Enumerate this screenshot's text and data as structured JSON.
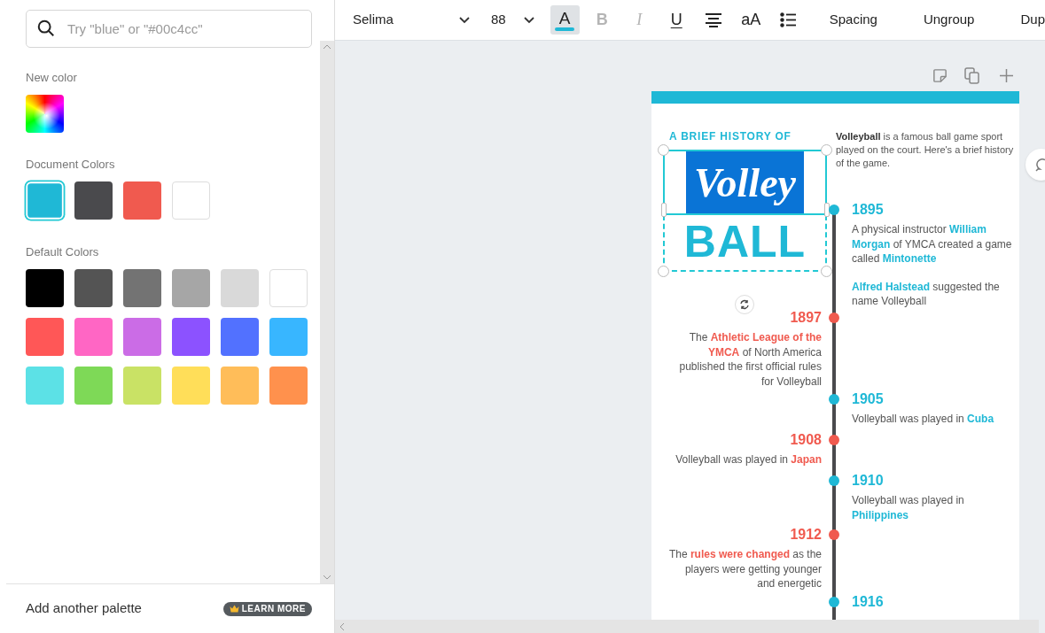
{
  "color_panel": {
    "search": {
      "placeholder": "Try \"blue\" or \"#00c4cc\""
    },
    "new_color": {
      "label": "New color"
    },
    "document_colors": {
      "label": "Document Colors",
      "swatches": [
        {
          "color": "#1fb8d6",
          "selected": true
        },
        {
          "color": "#4a4a4d",
          "selected": false
        },
        {
          "color": "#f05a4f",
          "selected": false
        },
        {
          "color": "#ffffff",
          "selected": false
        }
      ]
    },
    "default_colors": {
      "label": "Default Colors",
      "swatches": [
        {
          "color": "#000000",
          "selected": false
        },
        {
          "color": "#545454",
          "selected": false
        },
        {
          "color": "#737373",
          "selected": false
        },
        {
          "color": "#a6a6a6",
          "selected": false
        },
        {
          "color": "#d9d9d9",
          "selected": false
        },
        {
          "color": "#ffffff",
          "selected": false
        },
        {
          "color": "#ff5757",
          "selected": false
        },
        {
          "color": "#ff66c4",
          "selected": false
        },
        {
          "color": "#cb6ce6",
          "selected": false
        },
        {
          "color": "#8c52ff",
          "selected": false
        },
        {
          "color": "#5271ff",
          "selected": false
        },
        {
          "color": "#38b6ff",
          "selected": false
        },
        {
          "color": "#5ce1e6",
          "selected": false
        },
        {
          "color": "#7ed957",
          "selected": false
        },
        {
          "color": "#c9e265",
          "selected": false
        },
        {
          "color": "#ffde59",
          "selected": false
        },
        {
          "color": "#ffbd59",
          "selected": false
        },
        {
          "color": "#ff914d",
          "selected": false
        }
      ]
    },
    "footer": {
      "label": "Add another palette",
      "badge": "LEARN MORE"
    }
  },
  "toolbar": {
    "font": "Selima",
    "size": "88",
    "buttons": [
      {
        "kind": "text-color",
        "label": "A",
        "active": true,
        "disabled": false
      },
      {
        "kind": "bold",
        "label": "B",
        "active": false,
        "disabled": true
      },
      {
        "kind": "italic",
        "label": "I",
        "active": false,
        "disabled": true
      },
      {
        "kind": "underline",
        "label": "U",
        "active": false,
        "disabled": false
      },
      {
        "kind": "align",
        "active": false,
        "disabled": false
      },
      {
        "kind": "case",
        "label": "aA",
        "active": false,
        "disabled": false
      },
      {
        "kind": "list",
        "active": false,
        "disabled": false
      }
    ],
    "actions": [
      "Spacing",
      "Ungroup",
      "Dup"
    ]
  },
  "design": {
    "heading": "A BRIEF HISTORY OF",
    "title_script": "Volley",
    "title_block": "BALL",
    "intro": "**Volleyball** is a famous ball game sport played on the court. Here's a brief history of the game.",
    "timeline": [
      {
        "year": "1895",
        "color": "#1fb8d6",
        "paragraphs": [
          "A physical instructor **William Morgan** of YMCA created a game called **Mintonette**",
          "**Alfred Halstead** suggested the name Volleyball"
        ]
      },
      {
        "year": "1897",
        "color": "#f05a4f",
        "paragraphs": [
          "The **Athletic League of the YMCA** of North America published the first official rules for Volleyball"
        ]
      },
      {
        "year": "1905",
        "color": "#1fb8d6",
        "paragraphs": [
          "Volleyball was played in **Cuba**"
        ]
      },
      {
        "year": "1908",
        "color": "#f05a4f",
        "paragraphs": [
          "Volleyball was played in **Japan**"
        ]
      },
      {
        "year": "1910",
        "color": "#1fb8d6",
        "paragraphs": [
          "Volleyball was played in **Philippines**"
        ]
      },
      {
        "year": "1912",
        "color": "#f05a4f",
        "paragraphs": [
          "The **rules were changed** as the players were getting younger and energetic"
        ]
      },
      {
        "year": "1916",
        "color": "#1fb8d6"
      }
    ]
  }
}
